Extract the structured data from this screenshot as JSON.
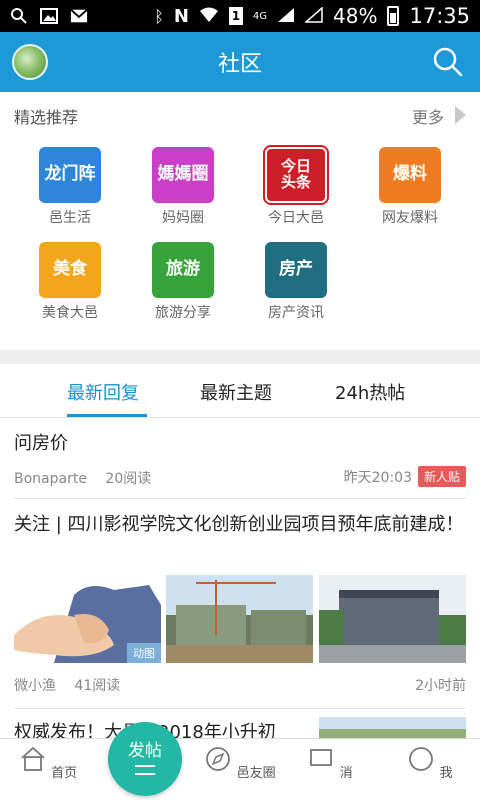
{
  "status_bar": {
    "battery": "48%",
    "time": "17:35",
    "network": "4G"
  },
  "header": {
    "title": "社区"
  },
  "featured": {
    "heading": "精选推荐",
    "more_label": "更多",
    "items": [
      {
        "icon_text": "龙门阵",
        "label": "邑生活",
        "color": "#2d86d9"
      },
      {
        "icon_text": "媽媽圈",
        "label": "妈妈圈",
        "color": "#c93fc8"
      },
      {
        "icon_text": "今日头条",
        "label": "今日大邑",
        "color": "#cc1f27"
      },
      {
        "icon_text": "爆料",
        "label": "网友爆料",
        "color": "#f07c22"
      },
      {
        "icon_text": "美食",
        "label": "美食大邑",
        "color": "#f3a51b"
      },
      {
        "icon_text": "旅游",
        "label": "旅游分享",
        "color": "#36a43a"
      },
      {
        "icon_text": "房产",
        "label": "房产资讯",
        "color": "#1f6e82"
      }
    ]
  },
  "tabs": [
    {
      "label": "最新回复",
      "active": true
    },
    {
      "label": "最新主题",
      "active": false
    },
    {
      "label": "24h热帖",
      "active": false
    }
  ],
  "posts": [
    {
      "title": "问房价",
      "author": "Bonaparte",
      "reads": "20阅读",
      "time": "昨天20:03",
      "badge": "新人贴"
    },
    {
      "title": "关注 | 四川影视学院文化创新创业园项目预年底前建成！",
      "author": "微小渔",
      "reads": "41阅读",
      "time": "2小时前",
      "gif_label": "动图"
    },
    {
      "title": "权威发布！大邑县2018年小升初"
    }
  ],
  "bottom_nav": {
    "home": "首页",
    "post_button": "发帖",
    "friends": "邑友圈",
    "item4": "消",
    "item5": "我"
  },
  "colors": {
    "primary": "#1d99d8",
    "tab_active": "#1d8fd6",
    "fab": "#23b7a6",
    "badge": "#e75a5a"
  }
}
